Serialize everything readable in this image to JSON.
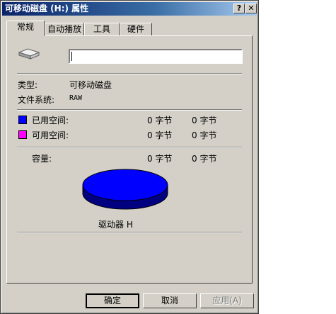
{
  "window": {
    "title": "可移动磁盘 (H:) 属性",
    "help_glyph": "?",
    "close_glyph": "✕"
  },
  "tabs": [
    {
      "label": "常规",
      "active": true
    },
    {
      "label": "自动播放",
      "active": false
    },
    {
      "label": "工具",
      "active": false
    },
    {
      "label": "硬件",
      "active": false
    }
  ],
  "general": {
    "drive_icon": "removable-drive-icon",
    "name_value": "",
    "type_label": "类型:",
    "type_value": "可移动磁盘",
    "fs_label": "文件系统:",
    "fs_value": "RAW",
    "used_label": "已用空间:",
    "used_color": "#0000ff",
    "used_bytes": "0 字节",
    "used_size": "0 字节",
    "free_label": "可用空间:",
    "free_color": "#ff00ff",
    "free_bytes": "0 字节",
    "free_size": "0 字节",
    "capacity_label": "容量:",
    "capacity_bytes": "0 字节",
    "capacity_size": "0 字节",
    "pie_color": "#0000ff",
    "drive_label": "驱动器 H"
  },
  "buttons": {
    "ok": "确定",
    "cancel": "取消",
    "apply": "应用(A)"
  }
}
